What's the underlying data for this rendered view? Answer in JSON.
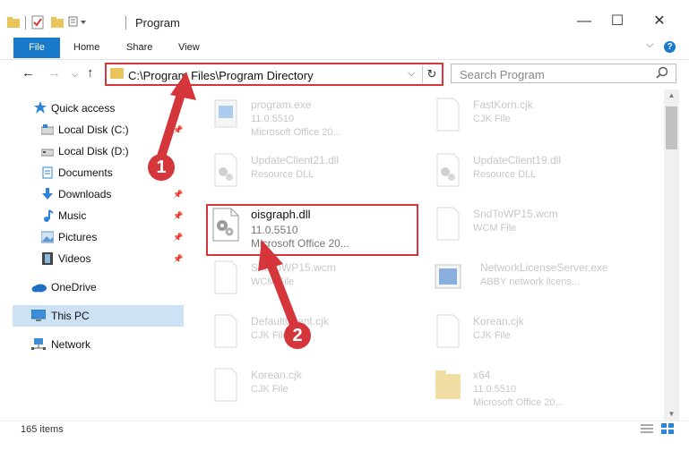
{
  "window": {
    "title": "Program",
    "minimize": "—",
    "maximize": "☐",
    "close": "✕"
  },
  "ribbon": {
    "file": "File",
    "tabs": [
      "Home",
      "Share",
      "View"
    ],
    "help": "?"
  },
  "address": {
    "path": "C:\\Program Files\\Program Directory",
    "search_placeholder": "Search Program"
  },
  "sidebar": {
    "items": [
      {
        "label": "Quick access",
        "icon": "star-icon"
      },
      {
        "label": "Local Disk (C:)",
        "icon": "drive-icon"
      },
      {
        "label": "Local Disk (D:)",
        "icon": "drive-icon"
      },
      {
        "label": "Documents",
        "icon": "documents-icon"
      },
      {
        "label": "Downloads",
        "icon": "downloads-icon"
      },
      {
        "label": "Music",
        "icon": "music-icon"
      },
      {
        "label": "Pictures",
        "icon": "pictures-icon"
      },
      {
        "label": "Videos",
        "icon": "videos-icon"
      },
      {
        "label": "OneDrive",
        "icon": "cloud-icon"
      },
      {
        "label": "This PC",
        "icon": "computer-icon"
      },
      {
        "label": "Network",
        "icon": "network-icon"
      }
    ]
  },
  "files": {
    "left": [
      {
        "name": "program.exe",
        "line2": "11.0.5510",
        "line3": "Microsoft Office 20..."
      },
      {
        "name": "UpdateClient21.dll",
        "line2": "Resource DLL",
        "line3": ""
      },
      {
        "name": "oisgraph.dll",
        "line2": "11.0.5510",
        "line3": "Microsoft Office 20..."
      },
      {
        "name": "SndToWP15.wcm",
        "line2": "WCM File",
        "line3": ""
      },
      {
        "name": "DefaultClient.cjk",
        "line2": "CJK File",
        "line3": ""
      },
      {
        "name": "Korean.cjk",
        "line2": "CJK File",
        "line3": ""
      }
    ],
    "right": [
      {
        "name": "FastKorn.cjk",
        "line2": "CJK File",
        "line3": ""
      },
      {
        "name": "UpdateClient19.dll",
        "line2": "Resource DLL",
        "line3": ""
      },
      {
        "name": "SndToWP15.wcm",
        "line2": "WCM File",
        "line3": ""
      },
      {
        "name": "NetworkLicenseServer.exe",
        "line2": "ABBY network licens...",
        "line3": ""
      },
      {
        "name": "Korean.cjk",
        "line2": "CJK File",
        "line3": ""
      },
      {
        "name": "x64",
        "line2": "11.0.5510",
        "line3": "Microsoft Office 20..."
      }
    ]
  },
  "callouts": [
    "1",
    "2"
  ],
  "status": {
    "items_count": "165 items"
  },
  "colors": {
    "accent": "#1979ca",
    "highlight_red": "#d4363b",
    "selection": "#cde3f5"
  }
}
